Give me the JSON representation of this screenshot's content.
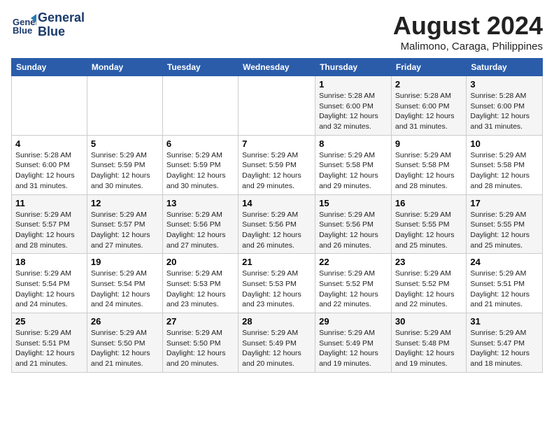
{
  "logo": {
    "line1": "General",
    "line2": "Blue"
  },
  "title": "August 2024",
  "subtitle": "Malimono, Caraga, Philippines",
  "days_of_week": [
    "Sunday",
    "Monday",
    "Tuesday",
    "Wednesday",
    "Thursday",
    "Friday",
    "Saturday"
  ],
  "weeks": [
    [
      {
        "day": "",
        "info": ""
      },
      {
        "day": "",
        "info": ""
      },
      {
        "day": "",
        "info": ""
      },
      {
        "day": "",
        "info": ""
      },
      {
        "day": "1",
        "info": "Sunrise: 5:28 AM\nSunset: 6:00 PM\nDaylight: 12 hours\nand 32 minutes."
      },
      {
        "day": "2",
        "info": "Sunrise: 5:28 AM\nSunset: 6:00 PM\nDaylight: 12 hours\nand 31 minutes."
      },
      {
        "day": "3",
        "info": "Sunrise: 5:28 AM\nSunset: 6:00 PM\nDaylight: 12 hours\nand 31 minutes."
      }
    ],
    [
      {
        "day": "4",
        "info": "Sunrise: 5:28 AM\nSunset: 6:00 PM\nDaylight: 12 hours\nand 31 minutes."
      },
      {
        "day": "5",
        "info": "Sunrise: 5:29 AM\nSunset: 5:59 PM\nDaylight: 12 hours\nand 30 minutes."
      },
      {
        "day": "6",
        "info": "Sunrise: 5:29 AM\nSunset: 5:59 PM\nDaylight: 12 hours\nand 30 minutes."
      },
      {
        "day": "7",
        "info": "Sunrise: 5:29 AM\nSunset: 5:59 PM\nDaylight: 12 hours\nand 29 minutes."
      },
      {
        "day": "8",
        "info": "Sunrise: 5:29 AM\nSunset: 5:58 PM\nDaylight: 12 hours\nand 29 minutes."
      },
      {
        "day": "9",
        "info": "Sunrise: 5:29 AM\nSunset: 5:58 PM\nDaylight: 12 hours\nand 28 minutes."
      },
      {
        "day": "10",
        "info": "Sunrise: 5:29 AM\nSunset: 5:58 PM\nDaylight: 12 hours\nand 28 minutes."
      }
    ],
    [
      {
        "day": "11",
        "info": "Sunrise: 5:29 AM\nSunset: 5:57 PM\nDaylight: 12 hours\nand 28 minutes."
      },
      {
        "day": "12",
        "info": "Sunrise: 5:29 AM\nSunset: 5:57 PM\nDaylight: 12 hours\nand 27 minutes."
      },
      {
        "day": "13",
        "info": "Sunrise: 5:29 AM\nSunset: 5:56 PM\nDaylight: 12 hours\nand 27 minutes."
      },
      {
        "day": "14",
        "info": "Sunrise: 5:29 AM\nSunset: 5:56 PM\nDaylight: 12 hours\nand 26 minutes."
      },
      {
        "day": "15",
        "info": "Sunrise: 5:29 AM\nSunset: 5:56 PM\nDaylight: 12 hours\nand 26 minutes."
      },
      {
        "day": "16",
        "info": "Sunrise: 5:29 AM\nSunset: 5:55 PM\nDaylight: 12 hours\nand 25 minutes."
      },
      {
        "day": "17",
        "info": "Sunrise: 5:29 AM\nSunset: 5:55 PM\nDaylight: 12 hours\nand 25 minutes."
      }
    ],
    [
      {
        "day": "18",
        "info": "Sunrise: 5:29 AM\nSunset: 5:54 PM\nDaylight: 12 hours\nand 24 minutes."
      },
      {
        "day": "19",
        "info": "Sunrise: 5:29 AM\nSunset: 5:54 PM\nDaylight: 12 hours\nand 24 minutes."
      },
      {
        "day": "20",
        "info": "Sunrise: 5:29 AM\nSunset: 5:53 PM\nDaylight: 12 hours\nand 23 minutes."
      },
      {
        "day": "21",
        "info": "Sunrise: 5:29 AM\nSunset: 5:53 PM\nDaylight: 12 hours\nand 23 minutes."
      },
      {
        "day": "22",
        "info": "Sunrise: 5:29 AM\nSunset: 5:52 PM\nDaylight: 12 hours\nand 22 minutes."
      },
      {
        "day": "23",
        "info": "Sunrise: 5:29 AM\nSunset: 5:52 PM\nDaylight: 12 hours\nand 22 minutes."
      },
      {
        "day": "24",
        "info": "Sunrise: 5:29 AM\nSunset: 5:51 PM\nDaylight: 12 hours\nand 21 minutes."
      }
    ],
    [
      {
        "day": "25",
        "info": "Sunrise: 5:29 AM\nSunset: 5:51 PM\nDaylight: 12 hours\nand 21 minutes."
      },
      {
        "day": "26",
        "info": "Sunrise: 5:29 AM\nSunset: 5:50 PM\nDaylight: 12 hours\nand 21 minutes."
      },
      {
        "day": "27",
        "info": "Sunrise: 5:29 AM\nSunset: 5:50 PM\nDaylight: 12 hours\nand 20 minutes."
      },
      {
        "day": "28",
        "info": "Sunrise: 5:29 AM\nSunset: 5:49 PM\nDaylight: 12 hours\nand 20 minutes."
      },
      {
        "day": "29",
        "info": "Sunrise: 5:29 AM\nSunset: 5:49 PM\nDaylight: 12 hours\nand 19 minutes."
      },
      {
        "day": "30",
        "info": "Sunrise: 5:29 AM\nSunset: 5:48 PM\nDaylight: 12 hours\nand 19 minutes."
      },
      {
        "day": "31",
        "info": "Sunrise: 5:29 AM\nSunset: 5:47 PM\nDaylight: 12 hours\nand 18 minutes."
      }
    ]
  ]
}
